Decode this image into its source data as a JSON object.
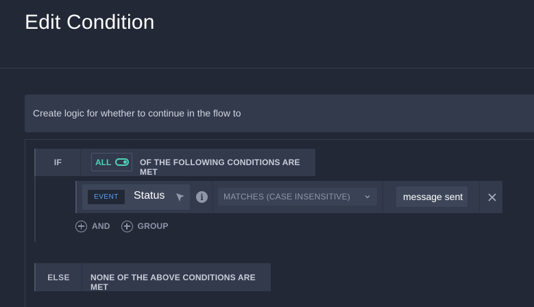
{
  "header": {
    "title": "Edit Condition"
  },
  "info": {
    "text": "Create logic for whether to continue in the flow to"
  },
  "if_block": {
    "label": "IF",
    "toggle_label": "ALL",
    "toggle_on": true,
    "conditions_text": "OF THE FOLLOWING CONDITIONS ARE MET"
  },
  "condition": {
    "badge": "EVENT",
    "field": "Status",
    "operator": "MATCHES (CASE INSENSITIVE)",
    "value": "message sent"
  },
  "add": {
    "and_label": "AND",
    "group_label": "GROUP"
  },
  "else_block": {
    "label": "ELSE",
    "text": "NONE OF THE ABOVE CONDITIONS ARE MET"
  },
  "colors": {
    "accent": "#4ed3b7",
    "event_badge": "#5aa0f2",
    "background": "#222836",
    "panel": "#323a4c"
  }
}
